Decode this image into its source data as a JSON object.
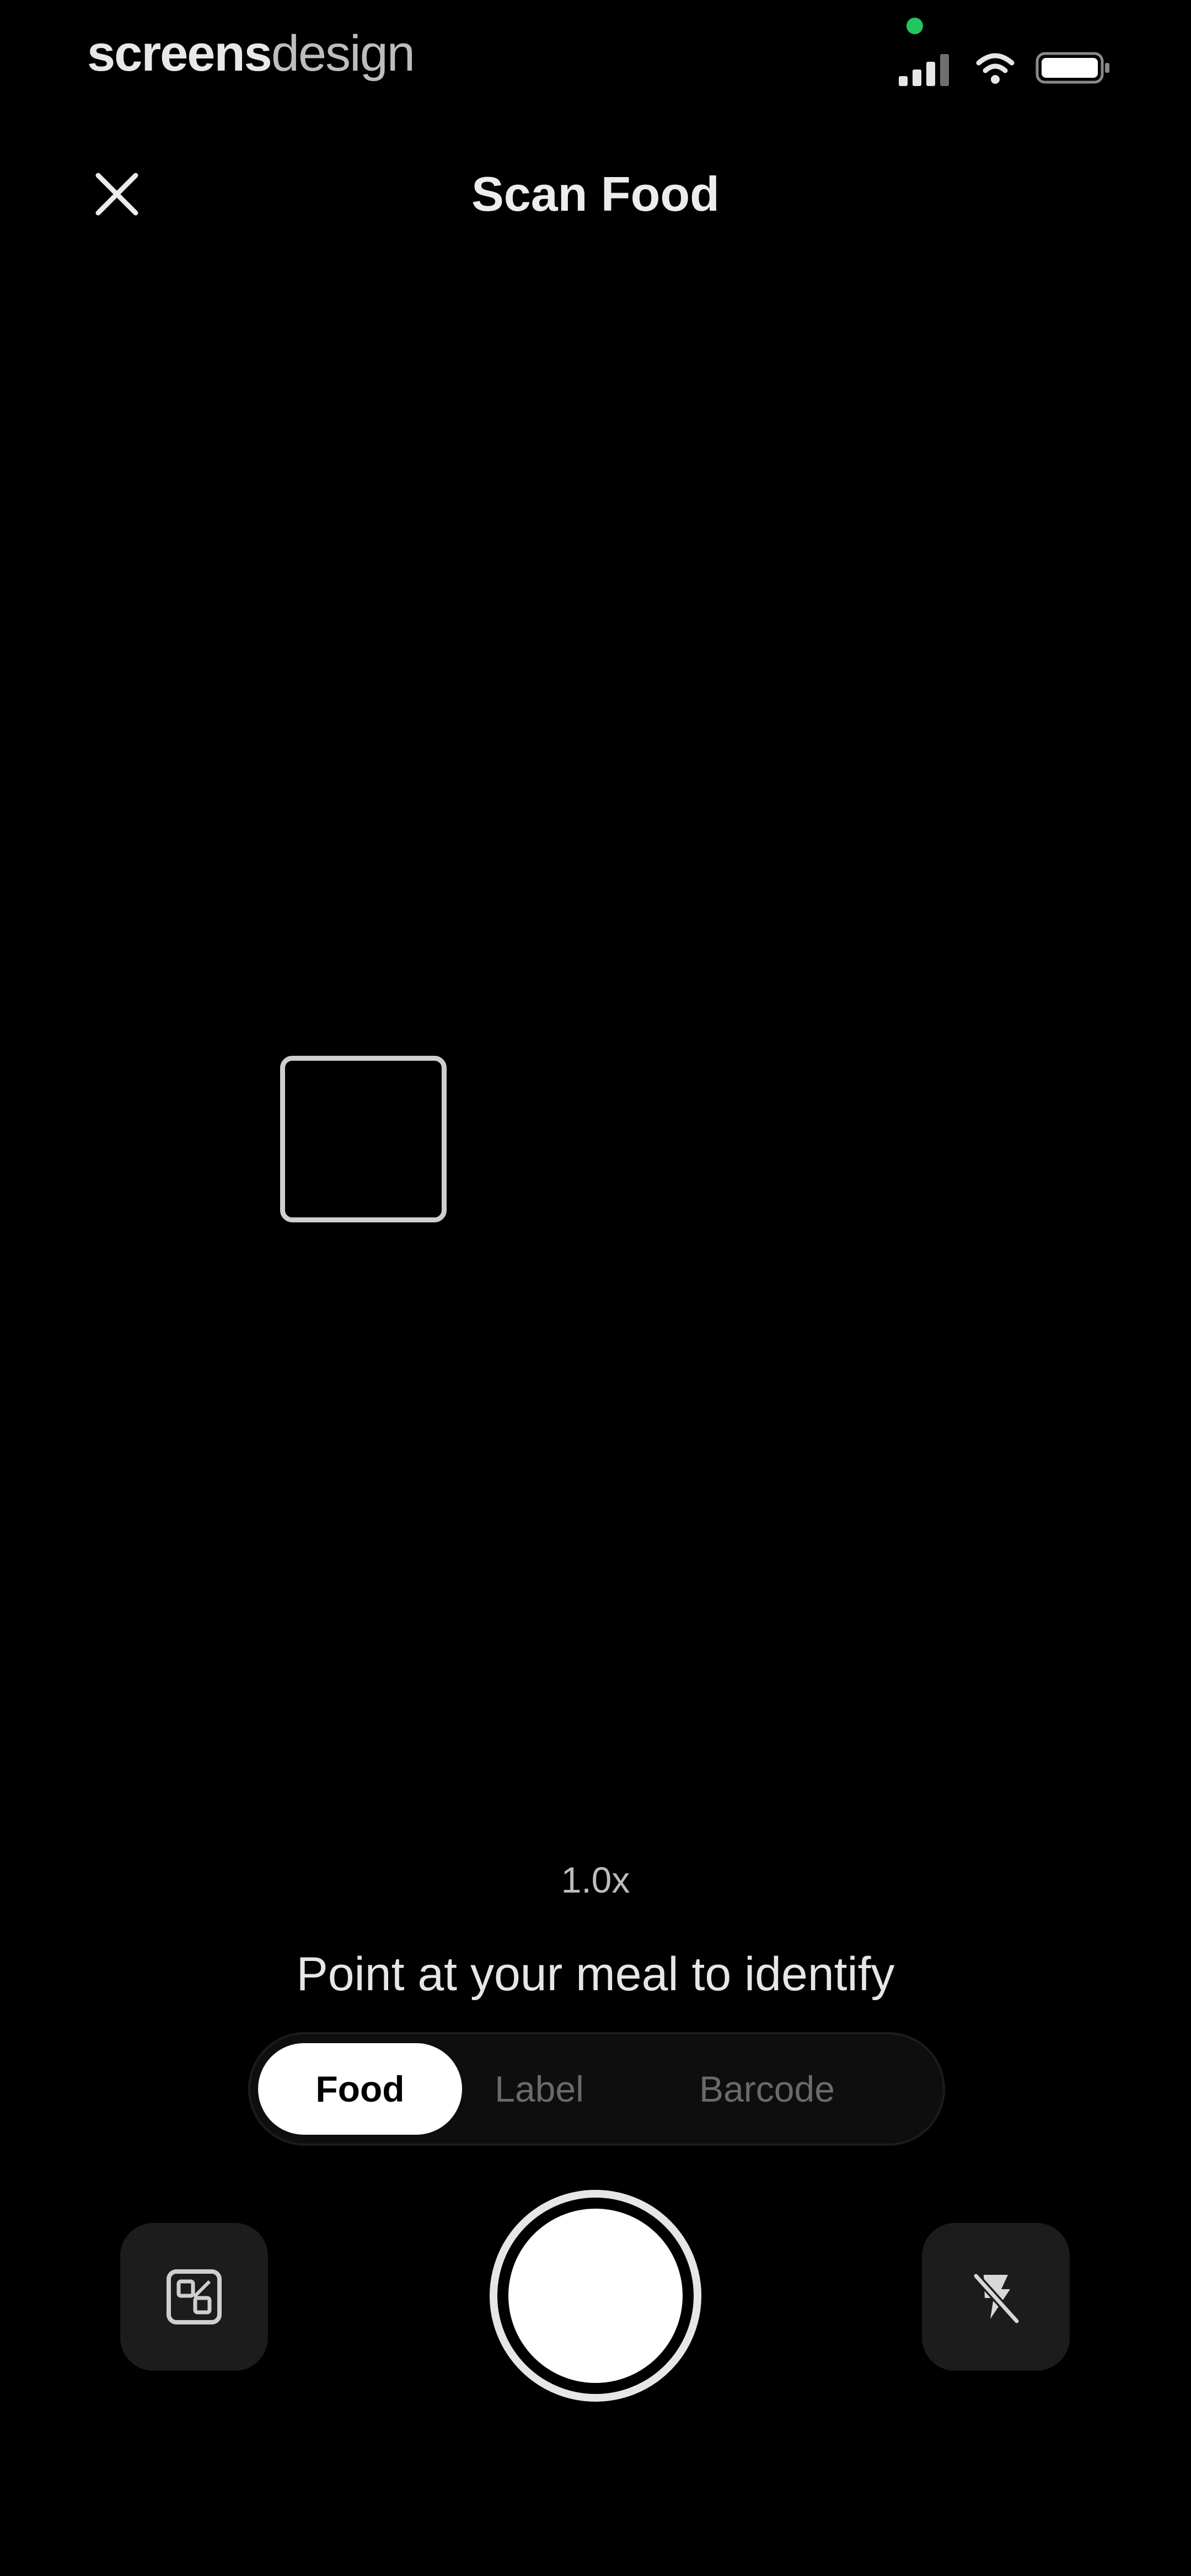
{
  "status_bar": {
    "brand_part1": "screens",
    "brand_part2": "design",
    "privacy_dot_color": "#22c55e"
  },
  "header": {
    "title": "Scan Food",
    "close_icon": "close-icon"
  },
  "camera": {
    "zoom": "1.0x",
    "hint": "Point at your meal to identify"
  },
  "modes": [
    {
      "label": "Food",
      "active": true
    },
    {
      "label": "Label",
      "active": false
    },
    {
      "label": "Barcode",
      "active": false
    }
  ],
  "controls": {
    "gallery_icon": "gallery-icon",
    "shutter_icon": "shutter-button",
    "flash_icon": "flash-off-icon"
  },
  "colors": {
    "background": "#000000",
    "control_surface": "#1c1c1c",
    "active_tab": "#ffffff"
  }
}
